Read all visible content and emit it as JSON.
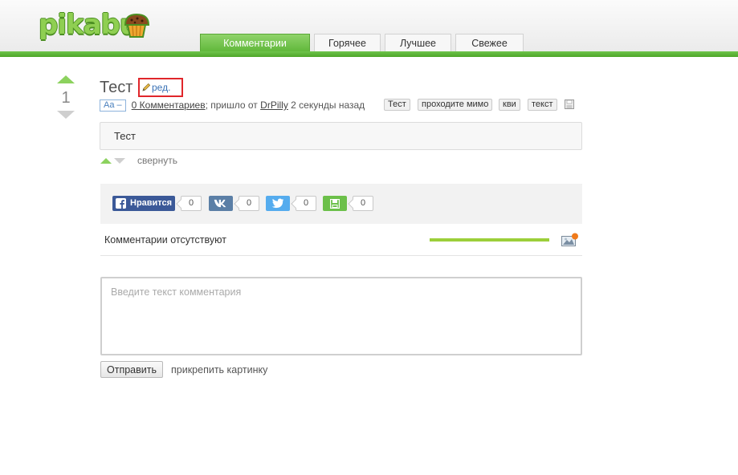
{
  "header": {
    "logo_text": "pikabu",
    "tabs": [
      {
        "label": "Комментарии",
        "active": true
      },
      {
        "label": "Горячее",
        "active": false
      },
      {
        "label": "Лучшее",
        "active": false
      },
      {
        "label": "Свежее",
        "active": false
      }
    ]
  },
  "post": {
    "rating": "1",
    "title": "Тест",
    "edit_label": "ред.",
    "font_toggle": "Aa –",
    "comments_link": "0 Комментариев",
    "came_from": "; пришло от",
    "author": "DrPilly",
    "time_ago": "2 секунды назад",
    "tags": [
      "Тест",
      "проходите мимо",
      "кви",
      "текст"
    ],
    "body": "Тест",
    "collapse_label": "свернуть"
  },
  "share": {
    "facebook_label": "Нравится",
    "facebook_count": "0",
    "vk_count": "0",
    "twitter_count": "0",
    "save_count": "0"
  },
  "comments": {
    "empty_text": "Комментарии отсутствуют",
    "input_placeholder": "Введите текст комментария",
    "submit_label": "Отправить",
    "attach_label": "прикрепить картинку"
  },
  "colors": {
    "brand_green": "#5cb436",
    "edit_highlight": "#e0262b",
    "facebook": "#3b5998",
    "vk": "#5b7fa6",
    "twitter": "#55acee",
    "save": "#6cc04a"
  }
}
